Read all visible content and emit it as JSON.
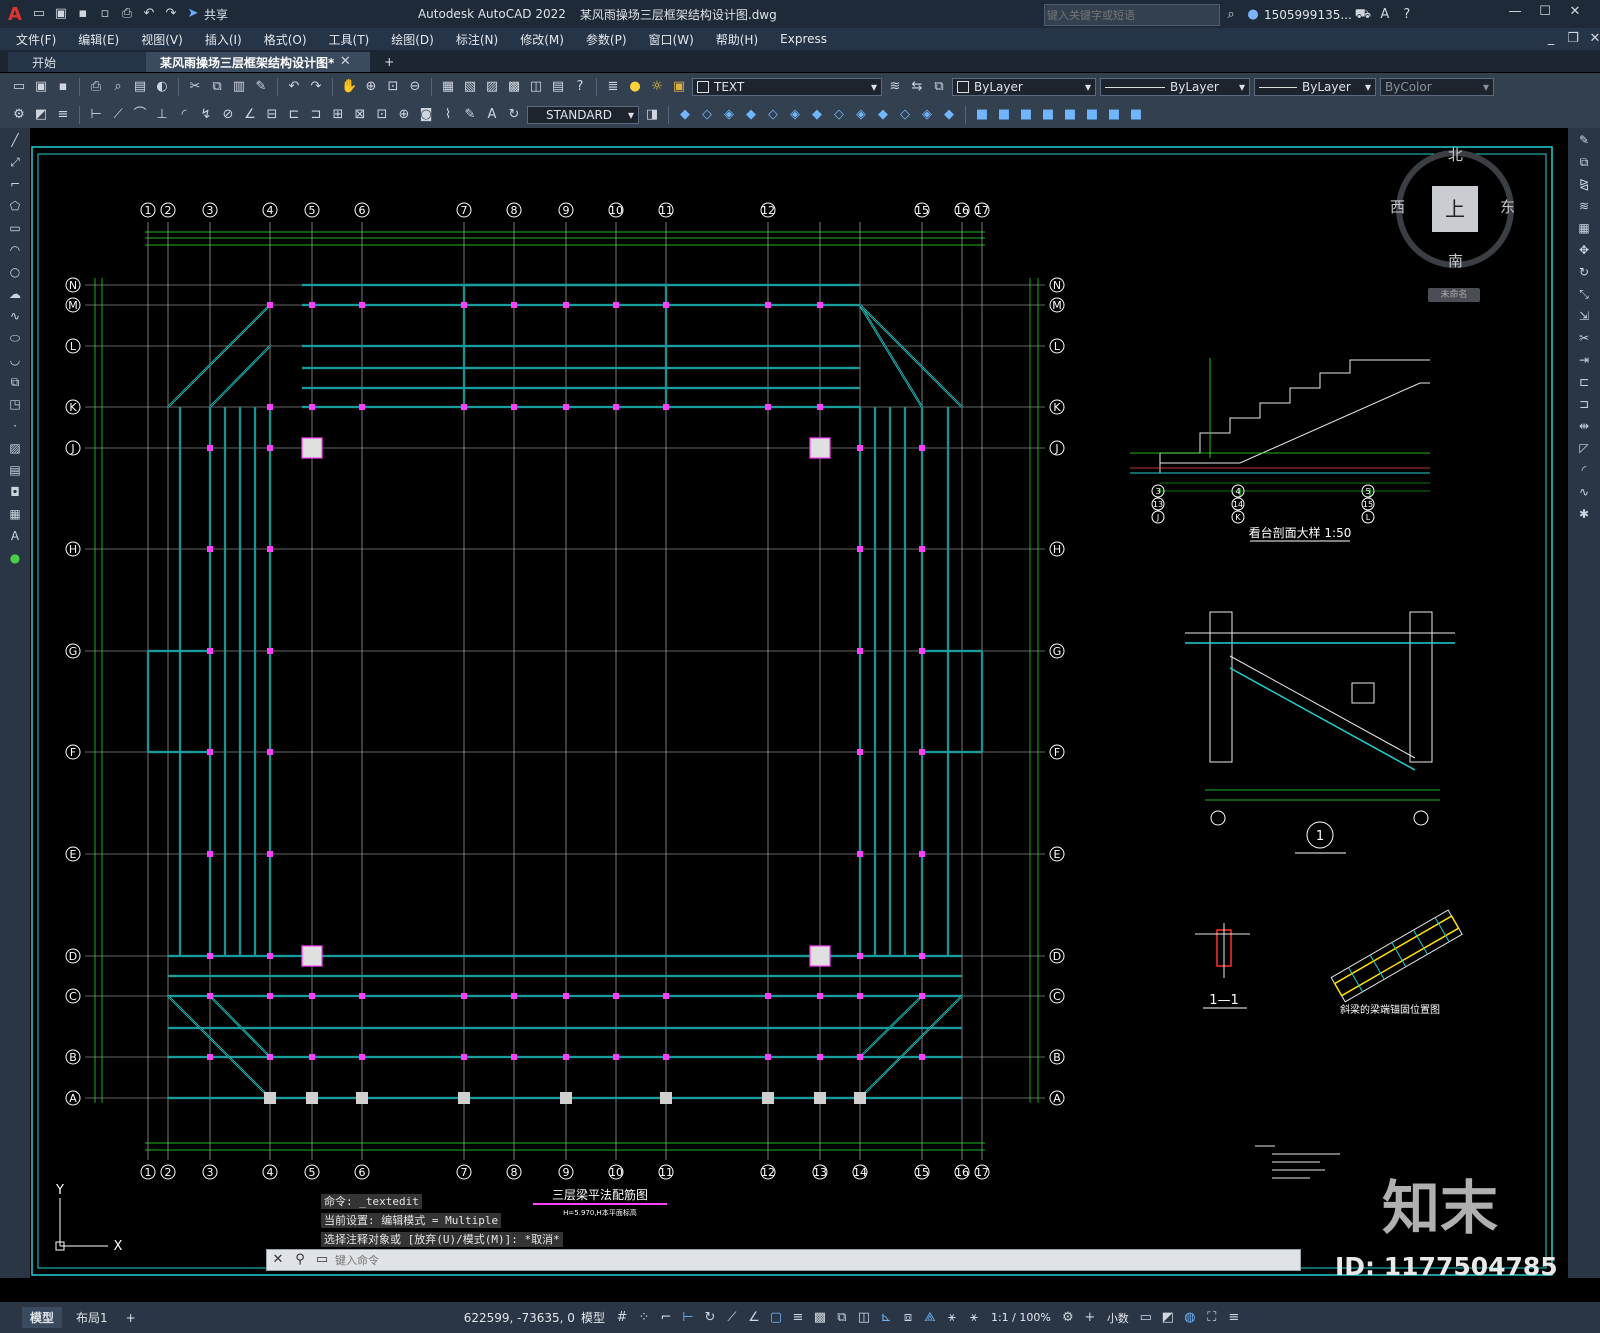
{
  "titlebar": {
    "logo": "A",
    "share": "共享",
    "app": "Autodesk AutoCAD 2022",
    "file": "某风雨操场三层框架结构设计图.dwg",
    "search_placeholder": "键入关键字或短语",
    "user": "1505999135...",
    "icons": [
      "new-icon",
      "open-icon",
      "save-icon",
      "saveas-icon",
      "print-icon",
      "undo-icon",
      "redo-icon"
    ]
  },
  "menu": [
    "文件(F)",
    "编辑(E)",
    "视图(V)",
    "插入(I)",
    "格式(O)",
    "工具(T)",
    "绘图(D)",
    "标注(N)",
    "修改(M)",
    "参数(P)",
    "窗口(W)",
    "帮助(H)",
    "Express"
  ],
  "tabs": {
    "start": "开始",
    "doc": "某风雨操场三层框架结构设计图*",
    "add": "+"
  },
  "toolbar": {
    "layer": "TEXT",
    "color": "ByLayer",
    "linetype": "ByLayer",
    "lineweight": "ByLayer",
    "plotstyle": "ByColor",
    "textstyle": "STANDARD"
  },
  "viewcube": {
    "north": "北",
    "south": "南",
    "east": "东",
    "west": "西",
    "top": "上",
    "wcs": "未命名"
  },
  "grid": {
    "cols_top": [
      "1",
      "2",
      "3",
      "4",
      "5",
      "6",
      "7",
      "8",
      "9",
      "10",
      "11",
      "12",
      "15",
      "16",
      "17"
    ],
    "cols_bottom": [
      "1",
      "2",
      "3",
      "4",
      "5",
      "6",
      "7",
      "8",
      "9",
      "10",
      "11",
      "12",
      "13",
      "14",
      "15",
      "16",
      "17"
    ],
    "rows": [
      "N",
      "M",
      "L",
      "K",
      "J",
      "H",
      "G",
      "F",
      "E",
      "D",
      "C",
      "B",
      "A"
    ]
  },
  "drawing": {
    "plan_title": "三层梁平法配筋图",
    "plan_subtitle": "H=5.970,H本平面标高",
    "section_title": "看台剖面大样 1:50",
    "detail_mark": "1",
    "section_mark": "1—1",
    "detail2_title": "斜梁的梁端锚固位置图",
    "section_axis_labels": [
      "3",
      "4",
      "5",
      "13",
      "14",
      "15",
      "J",
      "K",
      "L"
    ]
  },
  "command": {
    "history": [
      "命令: _textedit",
      "当前设置: 编辑模式 = Multiple",
      "选择注释对象或 [放弃(U)/模式(M)]: *取消*"
    ],
    "placeholder": "键入命令"
  },
  "ucs": {
    "x": "X",
    "y": "Y"
  },
  "watermark": {
    "brand": "知末",
    "id": "ID: 1177504785"
  },
  "status": {
    "layout_tabs": [
      "模型",
      "布局1"
    ],
    "coords": "622599, -73635, 0",
    "model": "模型",
    "scale": "1:1 / 100%",
    "units": "小数"
  }
}
